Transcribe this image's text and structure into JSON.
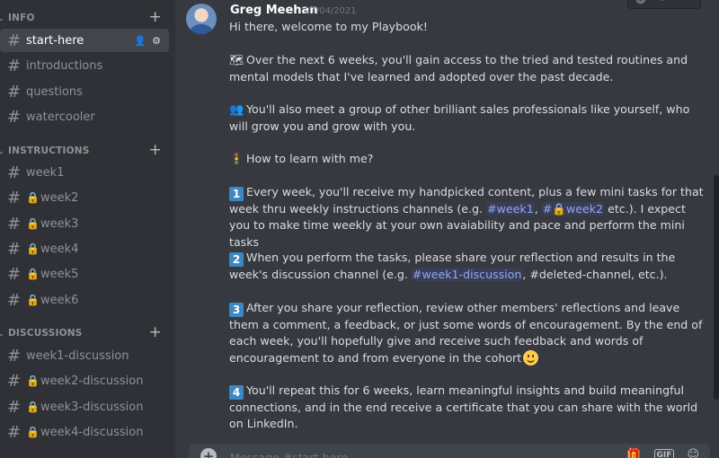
{
  "sidebar": {
    "categories": [
      {
        "label": "INFO"
      },
      {
        "label": "INSTRUCTIONS"
      },
      {
        "label": "DISCUSSIONS"
      }
    ],
    "channels": [
      {
        "name": "start-here"
      },
      {
        "name": "introductions"
      },
      {
        "name": "questions"
      },
      {
        "name": "watercooler"
      },
      {
        "name": "week1"
      },
      {
        "name": "week2"
      },
      {
        "name": "week3"
      },
      {
        "name": "week4"
      },
      {
        "name": "week5"
      },
      {
        "name": "week6"
      },
      {
        "name": "week1-discussion"
      },
      {
        "name": "week2-discussion"
      },
      {
        "name": "week3-discussion"
      },
      {
        "name": "week4-discussion"
      }
    ]
  },
  "message": {
    "author": "Greg Meehan",
    "timestamp": "27/04/2021",
    "greeting": "Hi there, welcome to my Playbook!",
    "p1": "Over the next 6 weeks, you'll gain access to the tried and tested routines and mental models that I've learned and adopted over the past decade.",
    "p2": "You'll also meet a group of other brilliant sales professionals like yourself, who will grow you and grow with you.",
    "p3": "How to learn with me?",
    "s1_a": "Every week, you'll receive my handpicked content, plus a few mini tasks for that week thru weekly instructions channels (e.g. ",
    "s1_m1": "#week1",
    "s1_m2": "week2",
    "s1_b": " etc.). I expect you to make time weekly at your own avaiability and pace and perform the mini tasks",
    "s2_a": "When you perform the tasks, please share your reflection and results in the week's discussion channel (e.g. ",
    "s2_m1": "#week1-discussion",
    "s2_b": ", #deleted-channel, etc.).",
    "s3": "After you share your reflection, review other members' reflections and leave them a comment, a feedback, or just some words of encouragement. By the end of each week, you'll hopefully give and receive such feedback and words of encouragement to and from everyone in the cohort",
    "s4": "You'll repeat this for 6 weeks, learn meaningful insights and build meaningful connections, and in the end receive a certificate that you can share with the world on LinkedIn."
  },
  "composer": {
    "placeholder": "Message #start-here"
  },
  "colors": {
    "accent": "#3b88c3",
    "mention": "#8fa6f5",
    "background": "#36393f",
    "sidebar": "#2f3136"
  },
  "icons": [
    "hash-icon",
    "lock-icon",
    "add-member-icon",
    "gear-icon",
    "plus-icon",
    "chevron-down-icon",
    "map-emoji",
    "people-emoji",
    "traffic-light-emoji",
    "smile-emoji",
    "gift-icon",
    "gif-icon",
    "emoji-picker-icon"
  ]
}
